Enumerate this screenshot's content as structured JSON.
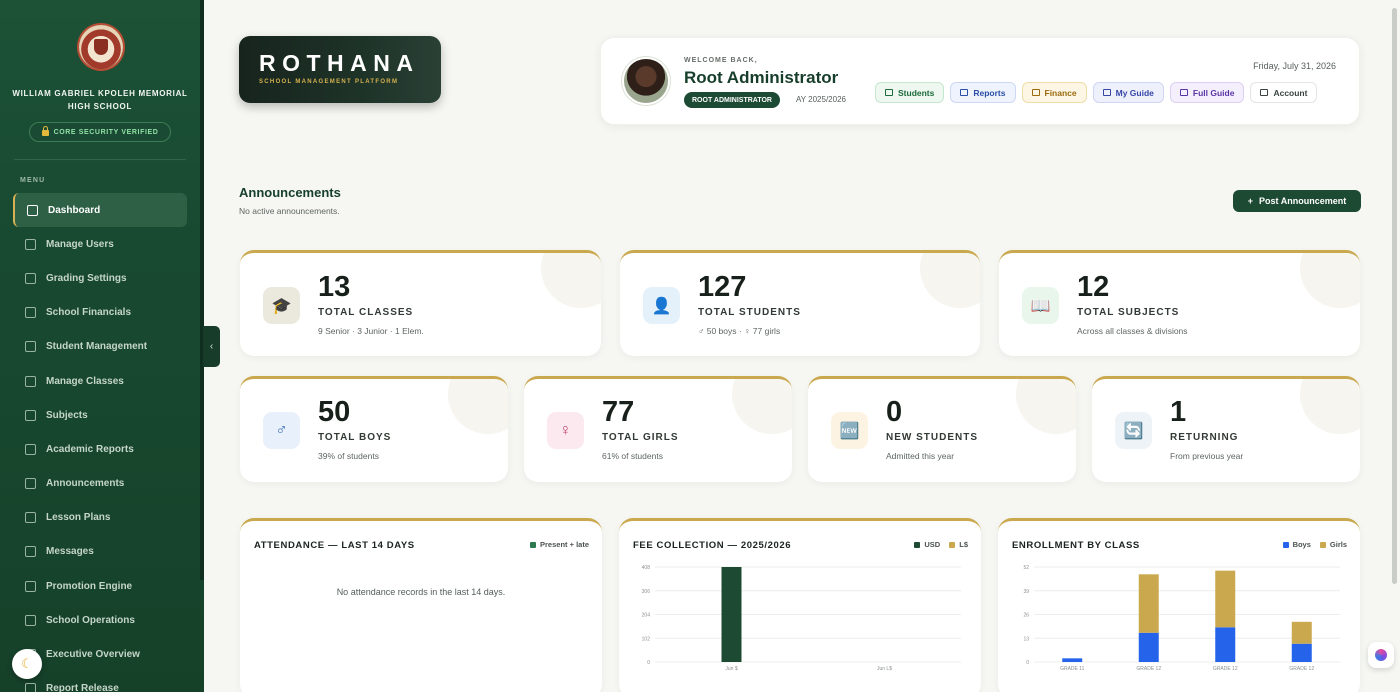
{
  "sidebar": {
    "school_name": "WILLIAM GABRIEL KPOLEH MEMORIAL HIGH SCHOOL",
    "security_badge": "CORE SECURITY VERIFIED",
    "menu_label": "MENU",
    "items": [
      {
        "label": "Dashboard",
        "icon": "home-icon",
        "active": true
      },
      {
        "label": "Manage Users",
        "icon": "users-icon"
      },
      {
        "label": "Grading Settings",
        "icon": "gear-icon"
      },
      {
        "label": "School Financials",
        "icon": "card-icon"
      },
      {
        "label": "Student Management",
        "icon": "student-icon"
      },
      {
        "label": "Manage Classes",
        "icon": "grid-icon"
      },
      {
        "label": "Subjects",
        "icon": "book-icon"
      },
      {
        "label": "Academic Reports",
        "icon": "bar-chart-icon"
      },
      {
        "label": "Announcements",
        "icon": "bell-icon"
      },
      {
        "label": "Lesson Plans",
        "icon": "document-icon"
      },
      {
        "label": "Messages",
        "icon": "chat-icon"
      },
      {
        "label": "Promotion Engine",
        "icon": "trend-icon"
      },
      {
        "label": "School Operations",
        "icon": "list-icon"
      },
      {
        "label": "Executive Overview",
        "icon": "eye-icon"
      },
      {
        "label": "Report Release",
        "icon": "lock-icon"
      }
    ]
  },
  "brand": {
    "title": "ROTHANA",
    "subtitle": "SCHOOL MANAGEMENT PLATFORM"
  },
  "header": {
    "welcome": "WELCOME BACK,",
    "name": "Root Administrator",
    "role": "ROOT ADMINISTRATOR",
    "academic_year": "AY 2025/2026",
    "date": "Friday, July 31, 2026",
    "quick_links": [
      {
        "label": "Students",
        "icon": "user-icon"
      },
      {
        "label": "Reports",
        "icon": "bar-chart-icon"
      },
      {
        "label": "Finance",
        "icon": "card-icon"
      },
      {
        "label": "My Guide",
        "icon": "document-icon"
      },
      {
        "label": "Full Guide",
        "icon": "book-icon"
      },
      {
        "label": "Account",
        "icon": "shield-icon"
      }
    ]
  },
  "announcements": {
    "title": "Announcements",
    "empty": "No active announcements.",
    "post_label": "Post Announcement"
  },
  "stats_top": [
    {
      "value": "13",
      "label": "TOTAL CLASSES",
      "sub": "9 Senior · 3 Junior · 1 Elem.",
      "icon": "graduation-cap-icon"
    },
    {
      "value": "127",
      "label": "TOTAL STUDENTS",
      "sub": "♂ 50 boys · ♀ 77 girls",
      "icon": "user-icon"
    },
    {
      "value": "12",
      "label": "TOTAL SUBJECTS",
      "sub": "Across all classes & divisions",
      "icon": "book-icon"
    }
  ],
  "stats_bottom": [
    {
      "value": "50",
      "label": "TOTAL BOYS",
      "sub": "39% of students",
      "icon": "male-icon"
    },
    {
      "value": "77",
      "label": "TOTAL GIRLS",
      "sub": "61% of students",
      "icon": "female-icon"
    },
    {
      "value": "0",
      "label": "NEW STUDENTS",
      "sub": "Admitted this year",
      "icon": "new-badge-icon"
    },
    {
      "value": "1",
      "label": "RETURNING",
      "sub": "From previous year",
      "icon": "refresh-icon"
    }
  ],
  "attendance": {
    "title": "ATTENDANCE — LAST 14 DAYS",
    "legend": "Present + late",
    "empty": "No attendance records in the last 14 days.",
    "color": "#2e7a4f"
  },
  "chart_data": [
    {
      "type": "bar",
      "title": "FEE COLLECTION — 2025/2026",
      "categories": [
        "Jun $",
        "Jun L$"
      ],
      "series": [
        {
          "name": "USD",
          "values": [
            408,
            0
          ],
          "color": "#1c4a33"
        },
        {
          "name": "L$",
          "values": [
            0,
            0
          ],
          "color": "#caa94e"
        }
      ],
      "yticks": [
        0,
        102,
        204,
        306,
        408
      ],
      "ylim": [
        0,
        408
      ]
    },
    {
      "type": "bar",
      "stacked": true,
      "title": "ENROLLMENT BY CLASS",
      "categories": [
        "GRADE 11",
        "GRADE 12",
        "GRADE 12",
        "GRADE 12"
      ],
      "series": [
        {
          "name": "Boys",
          "values": [
            2,
            16,
            19,
            10
          ],
          "color": "#2563eb"
        },
        {
          "name": "Girls",
          "values": [
            0,
            32,
            31,
            12
          ],
          "color": "#caa94e"
        }
      ],
      "yticks": [
        0,
        13,
        26,
        39,
        52
      ],
      "ylim": [
        0,
        52
      ]
    }
  ]
}
